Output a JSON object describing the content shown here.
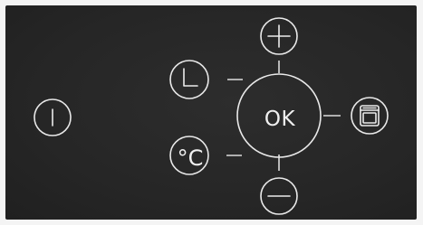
{
  "control_panel": {
    "ok_label": "OK",
    "temperature_label": "°C",
    "icons": {
      "power": "power-icon",
      "timer": "clock-icon",
      "temperature": "celsius-icon",
      "plus": "plus-icon",
      "minus": "minus-icon",
      "oven": "oven-icon"
    },
    "colors": {
      "background": "#262626",
      "foreground": "#e9e9e9"
    }
  }
}
